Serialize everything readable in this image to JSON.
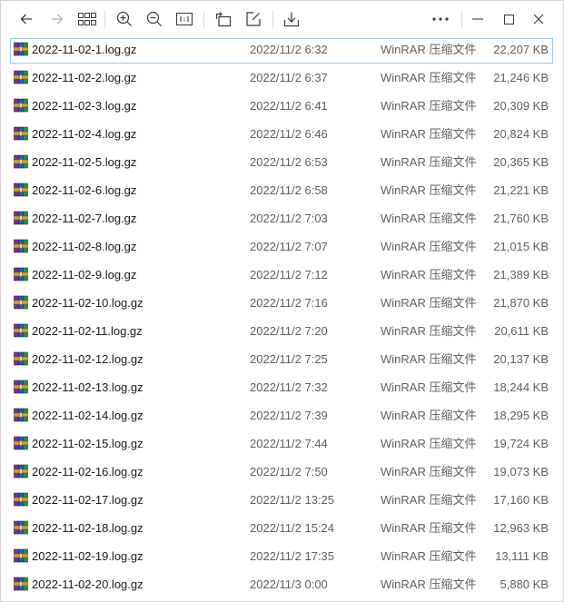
{
  "toolbar": {
    "icons": [
      "back-arrow-icon",
      "forward-arrow-icon",
      "grid-view-icon",
      "zoom-in-icon",
      "zoom-out-icon",
      "actual-size-icon",
      "rotate-icon",
      "edit-icon",
      "download-icon",
      "more-icon",
      "minimize-icon",
      "maximize-icon",
      "close-icon"
    ]
  },
  "colors": {
    "accent": "#99c9ef",
    "text": "#1a1a1a",
    "muted": "#5f5f5f"
  },
  "files": [
    {
      "name": "2022-11-02-1.log.gz",
      "date": "2022/11/2 6:32",
      "type": "WinRAR 压缩文件",
      "size": "22,207 KB"
    },
    {
      "name": "2022-11-02-2.log.gz",
      "date": "2022/11/2 6:37",
      "type": "WinRAR 压缩文件",
      "size": "21,246 KB"
    },
    {
      "name": "2022-11-02-3.log.gz",
      "date": "2022/11/2 6:41",
      "type": "WinRAR 压缩文件",
      "size": "20,309 KB"
    },
    {
      "name": "2022-11-02-4.log.gz",
      "date": "2022/11/2 6:46",
      "type": "WinRAR 压缩文件",
      "size": "20,824 KB"
    },
    {
      "name": "2022-11-02-5.log.gz",
      "date": "2022/11/2 6:53",
      "type": "WinRAR 压缩文件",
      "size": "20,365 KB"
    },
    {
      "name": "2022-11-02-6.log.gz",
      "date": "2022/11/2 6:58",
      "type": "WinRAR 压缩文件",
      "size": "21,221 KB"
    },
    {
      "name": "2022-11-02-7.log.gz",
      "date": "2022/11/2 7:03",
      "type": "WinRAR 压缩文件",
      "size": "21,760 KB"
    },
    {
      "name": "2022-11-02-8.log.gz",
      "date": "2022/11/2 7:07",
      "type": "WinRAR 压缩文件",
      "size": "21,015 KB"
    },
    {
      "name": "2022-11-02-9.log.gz",
      "date": "2022/11/2 7:12",
      "type": "WinRAR 压缩文件",
      "size": "21,389 KB"
    },
    {
      "name": "2022-11-02-10.log.gz",
      "date": "2022/11/2 7:16",
      "type": "WinRAR 压缩文件",
      "size": "21,870 KB"
    },
    {
      "name": "2022-11-02-11.log.gz",
      "date": "2022/11/2 7:20",
      "type": "WinRAR 压缩文件",
      "size": "20,611 KB"
    },
    {
      "name": "2022-11-02-12.log.gz",
      "date": "2022/11/2 7:25",
      "type": "WinRAR 压缩文件",
      "size": "20,137 KB"
    },
    {
      "name": "2022-11-02-13.log.gz",
      "date": "2022/11/2 7:32",
      "type": "WinRAR 压缩文件",
      "size": "18,244 KB"
    },
    {
      "name": "2022-11-02-14.log.gz",
      "date": "2022/11/2 7:39",
      "type": "WinRAR 压缩文件",
      "size": "18,295 KB"
    },
    {
      "name": "2022-11-02-15.log.gz",
      "date": "2022/11/2 7:44",
      "type": "WinRAR 压缩文件",
      "size": "19,724 KB"
    },
    {
      "name": "2022-11-02-16.log.gz",
      "date": "2022/11/2 7:50",
      "type": "WinRAR 压缩文件",
      "size": "19,073 KB"
    },
    {
      "name": "2022-11-02-17.log.gz",
      "date": "2022/11/2 13:25",
      "type": "WinRAR 压缩文件",
      "size": "17,160 KB"
    },
    {
      "name": "2022-11-02-18.log.gz",
      "date": "2022/11/2 15:24",
      "type": "WinRAR 压缩文件",
      "size": "12,963 KB"
    },
    {
      "name": "2022-11-02-19.log.gz",
      "date": "2022/11/2 17:35",
      "type": "WinRAR 压缩文件",
      "size": "13,111 KB"
    },
    {
      "name": "2022-11-02-20.log.gz",
      "date": "2022/11/3 0:00",
      "type": "WinRAR 压缩文件",
      "size": "5,880 KB"
    }
  ]
}
